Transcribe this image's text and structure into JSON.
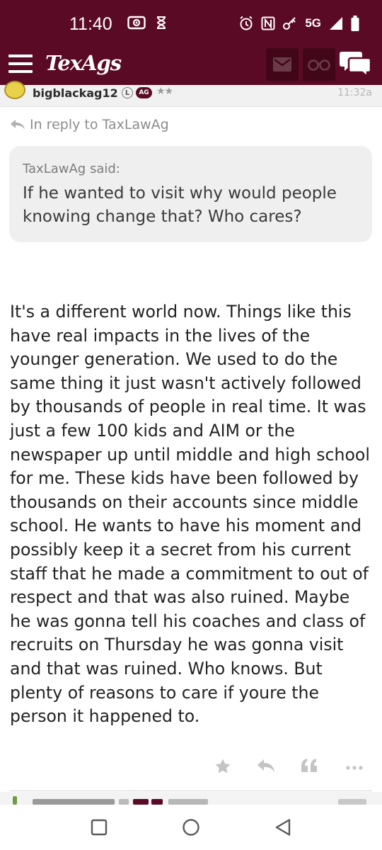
{
  "status_bar": {
    "time": "11:40",
    "network": "5G"
  },
  "app_bar": {
    "logo": "TexAgs",
    "icons": [
      "menu-icon",
      "mail-icon",
      "binoculars-icon",
      "chat-icon"
    ],
    "accent_color": "#5a0a24"
  },
  "post": {
    "username": "bigblackag12",
    "badge_l": "L",
    "badge_ag": "AG",
    "stars": "★★",
    "time": "11:32a",
    "reply_to": "In reply to TaxLawAg",
    "quote": {
      "author": "TaxLawAg said:",
      "text": "If he wanted to visit why would people knowing change that? Who cares?"
    },
    "body": "It's a different world now. Things like this have real impacts in the lives of the younger generation. We used to do the same thing it just wasn't actively followed by thousands of people in real time. It was just a few 100 kids and AIM or the newspaper up until middle and high school for me. These kids have been followed by thousands on their accounts since middle school. He wants to have his moment and possibly keep it a secret from his current staff that he made a commitment to out of respect and that was also ruined. Maybe he was gonna tell his coaches and class of recruits on Thursday he was gonna visit and that was ruined. Who knows. But plenty of reasons to care if youre the person it happened to.",
    "actions": [
      "star-icon",
      "reply-icon",
      "quote-icon",
      "more-icon"
    ]
  },
  "nav_bar": {
    "buttons": [
      "recents-icon",
      "home-icon",
      "back-icon"
    ]
  }
}
